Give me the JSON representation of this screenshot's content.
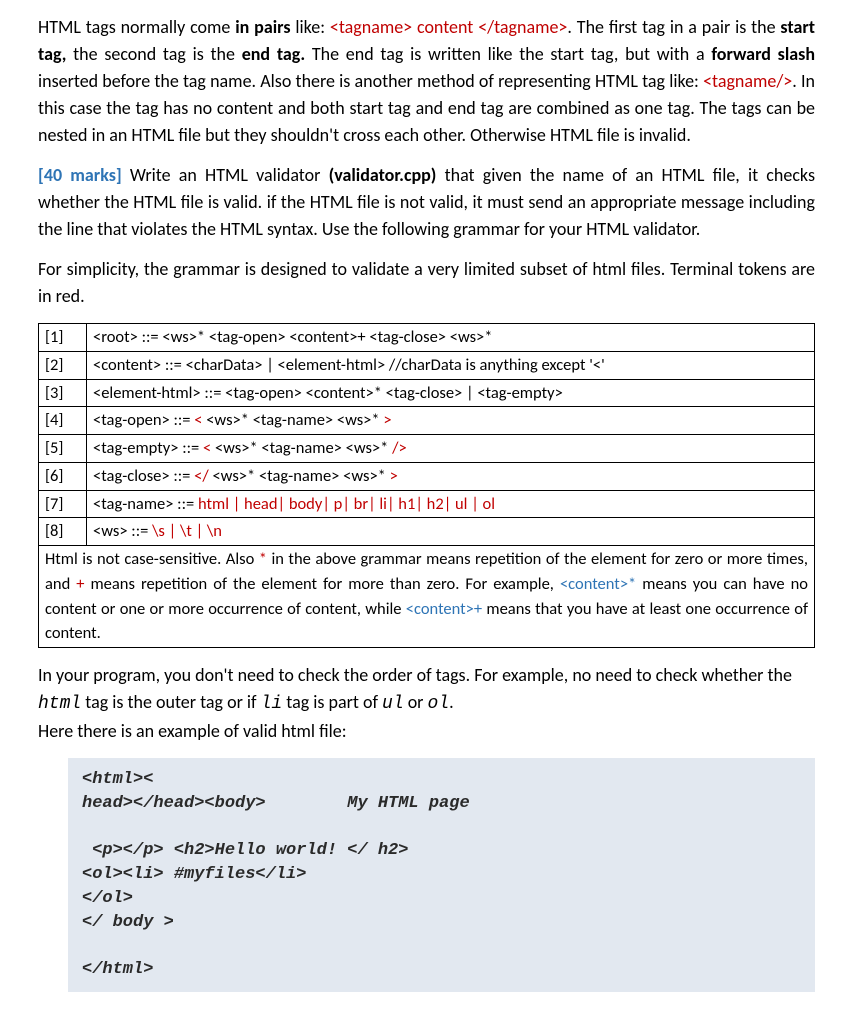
{
  "para1": {
    "t1": "HTML tags normally come ",
    "b1": "in pairs",
    "t2": " like: ",
    "code1": "<tagname> content </tagname>",
    "t3": ". The first tag in a pair is the ",
    "b2": "start tag,",
    "t4": " the second tag is the ",
    "b3": "end tag.",
    "t5": " The end tag is written like the start tag, but with a ",
    "b4": "forward slash",
    "t6": " inserted before the tag name. Also there is another method of representing HTML tag like: ",
    "code2": "<tagname/>",
    "t7": ". In this case the tag has no content and both start tag and end tag are combined as one tag. The tags can be nested in an HTML file but they shouldn't cross each other. Otherwise HTML file is invalid."
  },
  "para2": {
    "marks": "[40 marks]",
    "t1": " Write an HTML validator ",
    "b1": "(validator.cpp)",
    "t2": " that given the name of an HTML file, it checks whether the HTML file is valid. if the HTML file is not valid, it must send an appropriate message including the line that violates the HTML syntax. Use the following grammar for your HTML validator."
  },
  "para3": "For simplicity, the grammar is designed to validate a very limited subset of html files. Terminal tokens are in red.",
  "grammar": [
    {
      "n": "[1]",
      "lhs": "<root>",
      "op": " ::= ",
      "rhs": [
        {
          "t": "<ws>* "
        },
        {
          "t": " <tag-open>  <content>+  <tag-close>  "
        },
        {
          "t": "<ws>*"
        }
      ],
      "suffix": ""
    },
    {
      "n": "[2]",
      "lhs": "<content>",
      "op": " ::= ",
      "rhs": [
        {
          "t": "<charData> | <element-html>"
        }
      ],
      "suffix": "            //charData is anything except '<'"
    },
    {
      "n": "[3]",
      "lhs": "<element-html>",
      "op": " ::= ",
      "rhs": [
        {
          "t": "<tag-open>  <content>*  <tag-close>  |   <tag-empty>"
        }
      ]
    },
    {
      "n": "[4]",
      "lhs": "<tag-open>",
      "op": " ::= ",
      "prefix": "< ",
      "rhs": [
        {
          "t": " <ws>* <tag-name> <ws>*  "
        }
      ],
      "suffix2": ">"
    },
    {
      "n": "[5]",
      "lhs": "<tag-empty>",
      "op": " ::= ",
      "prefix": "< ",
      "rhs": [
        {
          "t": " <ws>* <tag-name> <ws>*  "
        }
      ],
      "suffix2": "/>"
    },
    {
      "n": "[6]",
      "lhs": "<tag-close>",
      "op": " ::= ",
      "prefix": "</ ",
      "rhs": [
        {
          "t": " <ws>* <tag-name> <ws>*  "
        }
      ],
      "suffix2": ">"
    },
    {
      "n": "[7]",
      "lhs": "<tag-name>",
      "op": " ::= ",
      "redtext": "html | head| body| p| br| li| h1| h2| ul | ol"
    },
    {
      "n": "[8]",
      "lhs": "<ws>",
      "op": " ::= ",
      "redtext": "\\s | \\t | \\n"
    }
  ],
  "note": {
    "t1": "Html is not case-sensitive. Also ",
    "star": "*",
    "t2": " in the above grammar means repetition of the element for zero or more times, and ",
    "plus": "+",
    "t3": " means repetition of the element for more than zero. For example, ",
    "ex1": "<content>*",
    "t4": " means you can have no content or one or more occurrence of content, while ",
    "ex2": "<content>+",
    "t5": " means that you have at least one occurrence of content."
  },
  "para4": {
    "t1": "In your program, you don't need to check the order of tags. For example, no need to check whether the ",
    "c1": "html",
    "t2": " tag is the outer tag or if ",
    "c2": "li",
    "t3": " tag is part of ",
    "c3": "ul",
    "t4": " or ",
    "c4": "ol",
    "t5": ".\nHere there is an example of valid html file:"
  },
  "codeblock": "<html><\nhead></head><body>        My HTML page\n\n <p></p> <h2>Hello world! </ h2>\n<ol><li> #myfiles</li>\n</ol>\n</ body >\n\n</html>"
}
